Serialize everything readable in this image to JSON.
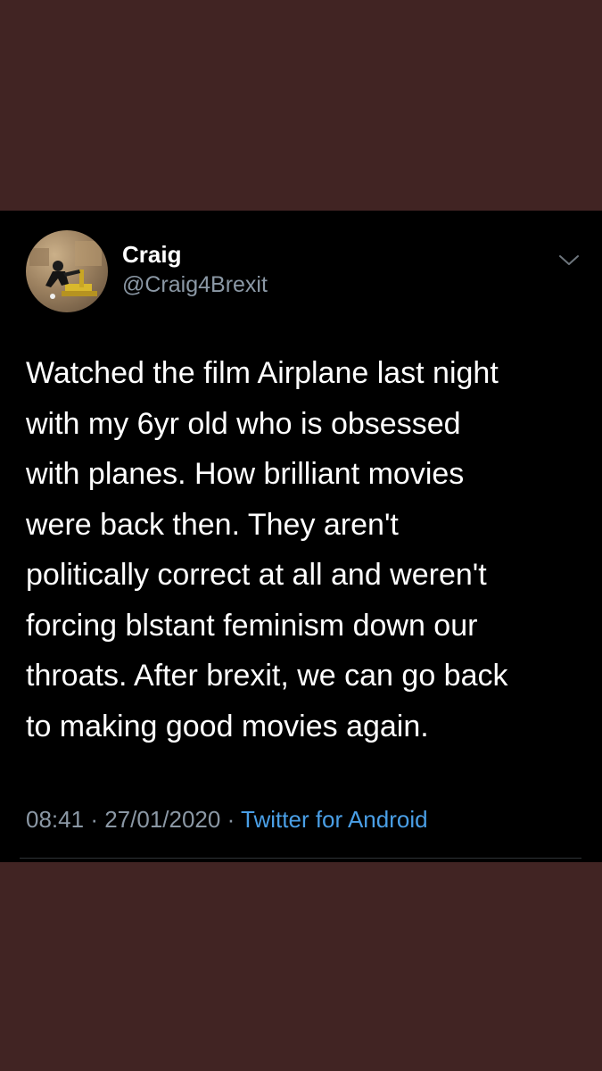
{
  "tweet": {
    "author": {
      "display_name": "Craig",
      "handle": "@Craig4Brexit"
    },
    "text": "Watched the film Airplane last night\nwith my 6yr old who is obsessed\nwith planes. How brilliant movies\nwere back then. They aren't\npolitically correct at all and weren't\nforcing blstant feminism down our\nthroats. After brexit, we can go back\nto making good movies again.",
    "time": "08:41",
    "date": "27/01/2020",
    "separator": "·",
    "source": "Twitter for Android"
  },
  "colors": {
    "page_background": "#412423",
    "card_background": "#000000",
    "text_primary": "#ffffff",
    "text_secondary": "#8b98a5",
    "link": "#4a9fe6"
  },
  "icons": {
    "menu": "chevron-down-icon"
  }
}
